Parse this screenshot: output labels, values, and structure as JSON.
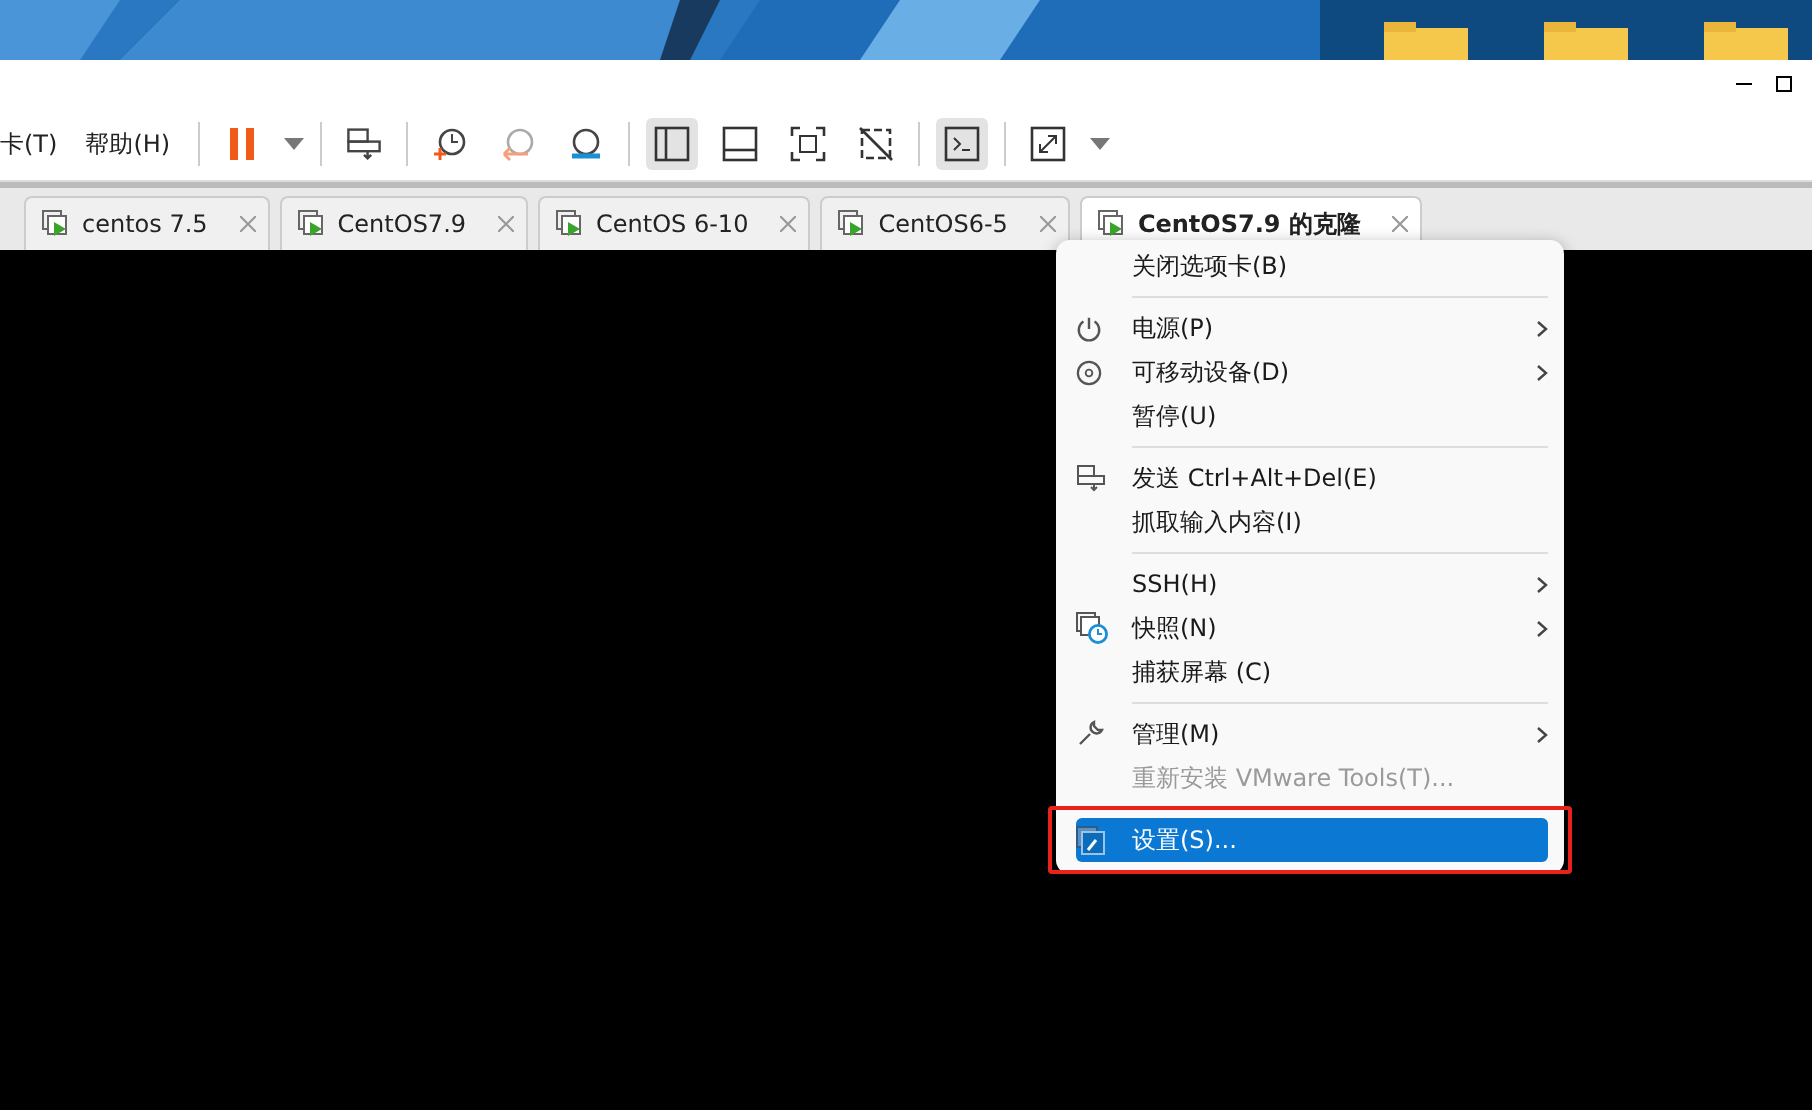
{
  "menu_bar": [
    "卡(T)",
    "帮助(H)"
  ],
  "tabs": [
    {
      "label": "centos 7.5",
      "selected": false
    },
    {
      "label": "CentOS7.9",
      "selected": false
    },
    {
      "label": "CentOS 6-10",
      "selected": false
    },
    {
      "label": "CentOS6-5",
      "selected": false
    },
    {
      "label": "CentOS7.9 的克隆",
      "selected": true
    }
  ],
  "context_menu": {
    "groups": [
      [
        {
          "label": "关闭选项卡(B)",
          "submenu": false,
          "disabled": false,
          "selected": false
        }
      ],
      [
        {
          "label": "电源(P)",
          "submenu": true,
          "disabled": false,
          "selected": false
        },
        {
          "label": "可移动设备(D)",
          "submenu": true,
          "disabled": false,
          "selected": false
        },
        {
          "label": "暂停(U)",
          "submenu": false,
          "disabled": false,
          "selected": false
        }
      ],
      [
        {
          "label": "发送 Ctrl+Alt+Del(E)",
          "submenu": false,
          "disabled": false,
          "selected": false
        },
        {
          "label": "抓取输入内容(I)",
          "submenu": false,
          "disabled": false,
          "selected": false
        }
      ],
      [
        {
          "label": "SSH(H)",
          "submenu": true,
          "disabled": false,
          "selected": false
        },
        {
          "label": "快照(N)",
          "submenu": true,
          "disabled": false,
          "selected": false
        },
        {
          "label": "捕获屏幕 (C)",
          "submenu": false,
          "disabled": false,
          "selected": false
        }
      ],
      [
        {
          "label": "管理(M)",
          "submenu": true,
          "disabled": false,
          "selected": false
        },
        {
          "label": "重新安装 VMware Tools(T)...",
          "submenu": false,
          "disabled": true,
          "selected": false
        }
      ],
      [
        {
          "label": "设置(S)...",
          "submenu": false,
          "disabled": false,
          "selected": true,
          "annotated": true
        }
      ]
    ]
  }
}
